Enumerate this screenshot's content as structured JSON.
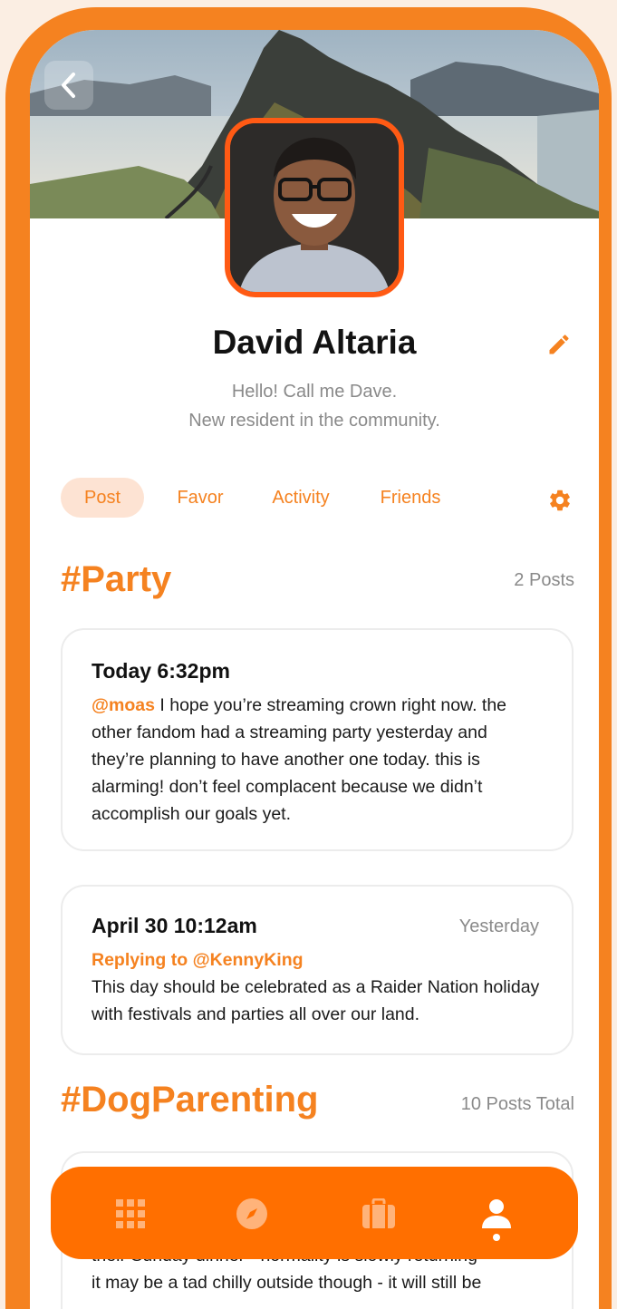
{
  "profile": {
    "name": "David Altaria",
    "bio_line1": "Hello! Call me Dave.",
    "bio_line2": "New resident in the community."
  },
  "tabs": [
    {
      "label": "Post",
      "active": true
    },
    {
      "label": "Favor",
      "active": false
    },
    {
      "label": "Activity",
      "active": false
    },
    {
      "label": "Friends",
      "active": false
    }
  ],
  "sections": [
    {
      "title": "#Party",
      "count": "2 Posts",
      "posts": [
        {
          "time": "Today 6:32pm",
          "mention": "@moas",
          "text": " I hope you’re streaming crown right now. the other fandom had a streaming party yesterday and they’re planning to have another one today. this is alarming! don’t feel complacent because we didn’t accomplish our goals yet."
        },
        {
          "time": "April 30 10:12am",
          "ago": "Yesterday",
          "reply_to": "Replying to @KennyKing",
          "text": "This day should be celebrated as a Raider Nation holiday with festivals and parties all over our land."
        }
      ]
    },
    {
      "title": "#DogParenting",
      "count": "10 Posts Total",
      "posts": [
        {
          "text_partial_1": "their Sunday dinner - normality is slowly returning",
          "text_partial_2": "it may be a tad chilly outside though - it will still be"
        }
      ]
    }
  ],
  "nav": {
    "items": [
      "grid-icon",
      "compass-icon",
      "briefcase-icon",
      "profile-icon"
    ],
    "active": "profile-icon"
  },
  "colors": {
    "accent": "#f58220",
    "nav": "#ff6f00",
    "avatar_border": "#ff5a14",
    "tab_active_bg": "#fde3d3"
  }
}
